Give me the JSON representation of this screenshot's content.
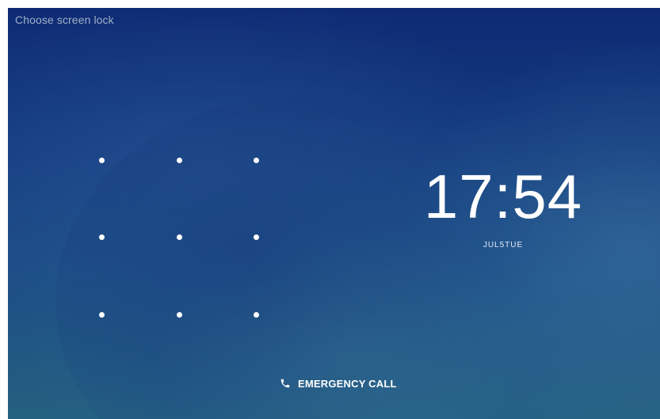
{
  "header": {
    "title": "Choose screen lock"
  },
  "lockscreen": {
    "time": "17:54",
    "date": "JUL5TUE",
    "pattern_dots": 9
  },
  "emergency": {
    "label": "EMERGENCY CALL",
    "icon": "phone-icon"
  }
}
